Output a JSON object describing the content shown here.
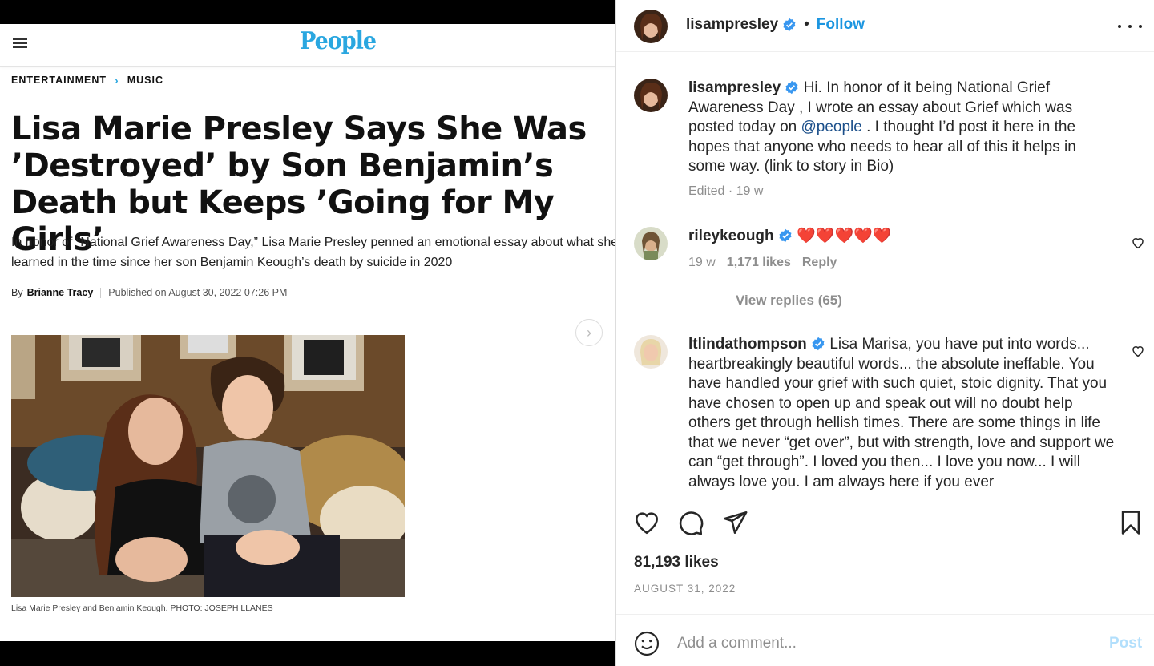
{
  "people": {
    "logo": "People",
    "breadcrumb": {
      "section": "ENTERTAINMENT",
      "separator": "›",
      "subsection": "MUSIC"
    },
    "title": "Lisa Marie Presley Says She Was ’Destroyed’ by Son Benjamin’s Death but Keeps ’Going for My Girls’",
    "dek": "In honor of “National Grief Awareness Day,” Lisa Marie Presley penned an emotional essay about what she learned in the time since her son Benjamin Keough’s death by suicide in 2020",
    "byline": {
      "by": "By",
      "author": "Brianne Tracy",
      "published": "Published on August 30, 2022 07:26 PM"
    },
    "caption": "Lisa Marie Presley and Benjamin Keough. PHOTO: JOSEPH LLANES",
    "next_arrow": "›"
  },
  "instagram": {
    "header": {
      "username": "lisampresley",
      "dot": "•",
      "follow": "Follow"
    },
    "caption": {
      "username": "lisampresley",
      "text_before": " Hi. In honor of it being National Grief Awareness Day , I wrote an essay about Grief which was posted today on ",
      "mention": "@people",
      "text_after": " . I thought I’d post it here in the hopes that anyone who needs to hear all of this it helps in some way. (link to story in Bio)",
      "meta": "Edited · 19 w"
    },
    "comments": [
      {
        "username": "rileykeough",
        "text": "❤️❤️❤️❤️❤️",
        "age": "19 w",
        "likes": "1,171 likes",
        "reply": "Reply",
        "view_replies": "View replies (65)"
      },
      {
        "username": "ltlindathompson",
        "text": " Lisa Marisa, you have put into words... heartbreakingly beautiful words... the absolute ineffable. You have handled your grief with such quiet, stoic dignity. That you have chosen to open up and speak out will no doubt help others get through hellish times. There are some things in life that we never “get over”, but with strength, love and support we can “get through”. I loved you then... I love you now... I will always love you. I am always here if you ever"
      }
    ],
    "likes": "81,193 likes",
    "date": "AUGUST 31, 2022",
    "comment_box": {
      "placeholder": "Add a comment...",
      "post": "Post"
    },
    "colors": {
      "accent": "#1b95e0",
      "verified": "#3897f0",
      "post_disabled": "#b2dffc"
    }
  }
}
